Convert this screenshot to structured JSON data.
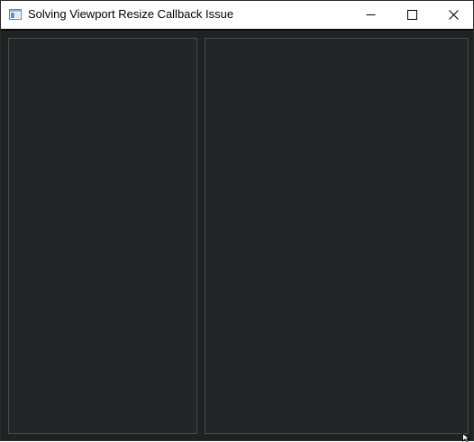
{
  "window": {
    "title": "Solving Viewport Resize Callback Issue",
    "app_icon": "window-app-icon",
    "controls": {
      "minimize_icon": "minimize-icon",
      "maximize_icon": "maximize-icon",
      "close_icon": "close-icon"
    }
  },
  "colors": {
    "titlebar_bg": "#ffffff",
    "client_bg": "#202123",
    "panel_bg": "#242527",
    "panel_border": "#4a4b4d"
  },
  "panels": [
    {
      "name": "left-panel"
    },
    {
      "name": "right-panel"
    }
  ]
}
